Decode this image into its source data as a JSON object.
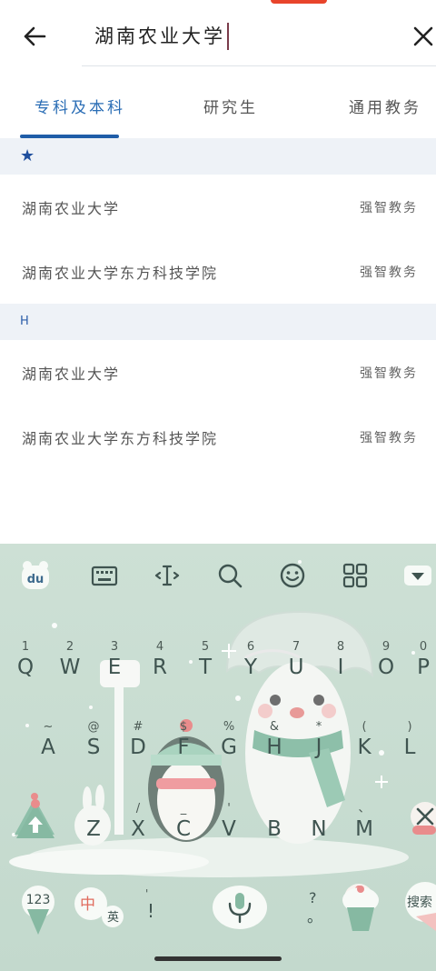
{
  "header": {
    "search_value": "湖南农业大学",
    "back_icon": "arrow-left-icon",
    "clear_icon": "close-icon"
  },
  "tabs": [
    {
      "label": "专科及本科",
      "active": true
    },
    {
      "label": "研究生",
      "active": false
    },
    {
      "label": "通用教务",
      "active": false
    }
  ],
  "sections": [
    {
      "header": "★",
      "rows": [
        {
          "name": "湖南农业大学",
          "tag": "强智教务"
        },
        {
          "name": "湖南农业大学东方科技学院",
          "tag": "强智教务"
        }
      ]
    },
    {
      "header": "H",
      "rows": [
        {
          "name": "湖南农业大学",
          "tag": "强智教务"
        },
        {
          "name": "湖南农业大学东方科技学院",
          "tag": "强智教务"
        }
      ]
    }
  ],
  "keyboard": {
    "toolbar": [
      "du",
      "keyboard-icon",
      "cursor-icon",
      "search-icon",
      "emoji-icon",
      "grid-icon",
      "collapse-icon"
    ],
    "row1": [
      {
        "num": "1",
        "letter": "Q"
      },
      {
        "num": "2",
        "letter": "W"
      },
      {
        "num": "3",
        "letter": "E"
      },
      {
        "num": "4",
        "letter": "R"
      },
      {
        "num": "5",
        "letter": "T"
      },
      {
        "num": "6",
        "letter": "Y"
      },
      {
        "num": "7",
        "letter": "U"
      },
      {
        "num": "8",
        "letter": "I"
      },
      {
        "num": "9",
        "letter": "O"
      },
      {
        "num": "0",
        "letter": "P"
      }
    ],
    "row2": [
      {
        "num": "~",
        "letter": "A"
      },
      {
        "num": "@",
        "letter": "S"
      },
      {
        "num": "#",
        "letter": "D"
      },
      {
        "num": "$",
        "letter": "F"
      },
      {
        "num": "%",
        "letter": "G"
      },
      {
        "num": "&",
        "letter": "H"
      },
      {
        "num": "*",
        "letter": "J"
      },
      {
        "num": "(",
        "letter": "K"
      },
      {
        "num": ")",
        "letter": "L"
      }
    ],
    "row3": [
      {
        "num": "",
        "letter": "Z"
      },
      {
        "num": "/",
        "letter": "X"
      },
      {
        "num": "_",
        "letter": "C"
      },
      {
        "num": "'",
        "letter": "V"
      },
      {
        "num": "",
        "letter": "B"
      },
      {
        "num": "",
        "letter": "N"
      },
      {
        "num": "、",
        "letter": "M"
      }
    ],
    "bottom": {
      "numbers": "123",
      "lang_cn": "中",
      "lang_en": "英",
      "excl": "!",
      "question": "?",
      "period": "。",
      "search": "搜索",
      "quote": "'",
      "comma": "，"
    }
  }
}
